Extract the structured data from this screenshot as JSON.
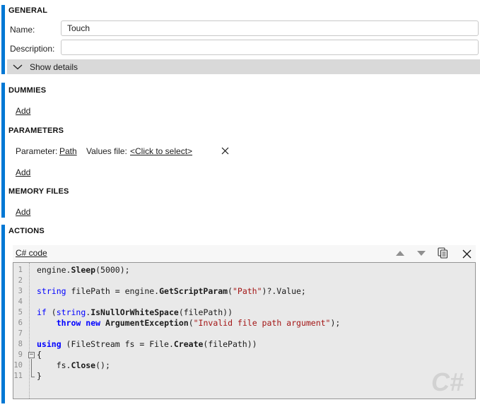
{
  "colors": {
    "accent_blue": "#0078d4",
    "expander_gray": "#d9d9d9",
    "code_background": "#e9e9e9",
    "keyword_blue": "#0000ff",
    "string_red": "#a31515",
    "watermark_gray": "#d2d2d2"
  },
  "general": {
    "heading": "GENERAL",
    "name_label": "Name:",
    "name_value": "Touch",
    "description_label": "Description:",
    "description_value": "",
    "show_details_label": "Show details"
  },
  "dummies": {
    "heading": "DUMMIES",
    "add_label": "Add"
  },
  "parameters": {
    "heading": "PARAMETERS",
    "rows": [
      {
        "parameter_label": "Parameter:",
        "parameter_value": "Path",
        "values_file_label": "Values file:",
        "values_file_value": "<Click to select>",
        "delete_icon": "x-icon"
      }
    ],
    "add_label": "Add"
  },
  "memory_files": {
    "heading": "MEMORY FILES",
    "add_label": "Add"
  },
  "actions": {
    "heading": "ACTIONS",
    "editor": {
      "title": "C# code",
      "toolbar_icons": [
        "move-up-icon",
        "move-down-icon",
        "copy-icon",
        "close-icon"
      ],
      "watermark": "C#",
      "code_lines": [
        {
          "num": "1",
          "fold": "",
          "tokens": [
            [
              "engine.",
              "plain"
            ],
            [
              "Sleep",
              "method"
            ],
            [
              "(5000);",
              "plain"
            ]
          ]
        },
        {
          "num": "2",
          "fold": "",
          "tokens": []
        },
        {
          "num": "3",
          "fold": "",
          "tokens": [
            [
              "string",
              "kw"
            ],
            [
              " filePath = engine.",
              "plain"
            ],
            [
              "GetScriptParam",
              "method"
            ],
            [
              "(",
              "plain"
            ],
            [
              "\"Path\"",
              "str"
            ],
            [
              ")?.Value;",
              "plain"
            ]
          ]
        },
        {
          "num": "4",
          "fold": "",
          "tokens": []
        },
        {
          "num": "5",
          "fold": "",
          "tokens": [
            [
              "if",
              "kw"
            ],
            [
              " (",
              "plain"
            ],
            [
              "string",
              "kw"
            ],
            [
              ".",
              "plain"
            ],
            [
              "IsNullOrWhiteSpace",
              "method"
            ],
            [
              "(filePath))",
              "plain"
            ]
          ]
        },
        {
          "num": "6",
          "fold": "",
          "tokens": [
            [
              "    ",
              "plain"
            ],
            [
              "throw",
              "kwb"
            ],
            [
              " ",
              "plain"
            ],
            [
              "new",
              "kwb"
            ],
            [
              " ",
              "plain"
            ],
            [
              "ArgumentException",
              "method"
            ],
            [
              "(",
              "plain"
            ],
            [
              "\"Invalid file path argument\"",
              "str"
            ],
            [
              ");",
              "plain"
            ]
          ]
        },
        {
          "num": "7",
          "fold": "",
          "tokens": []
        },
        {
          "num": "8",
          "fold": "",
          "tokens": [
            [
              "using",
              "kwb"
            ],
            [
              " (FileStream fs = File.",
              "plain"
            ],
            [
              "Create",
              "method"
            ],
            [
              "(filePath))",
              "plain"
            ]
          ]
        },
        {
          "num": "9",
          "fold": "start",
          "tokens": [
            [
              "{",
              "plain"
            ]
          ]
        },
        {
          "num": "10",
          "fold": "mid",
          "tokens": [
            [
              "    fs.",
              "plain"
            ],
            [
              "Close",
              "method"
            ],
            [
              "();",
              "plain"
            ]
          ]
        },
        {
          "num": "11",
          "fold": "end",
          "tokens": [
            [
              "}",
              "plain"
            ]
          ]
        }
      ]
    }
  }
}
